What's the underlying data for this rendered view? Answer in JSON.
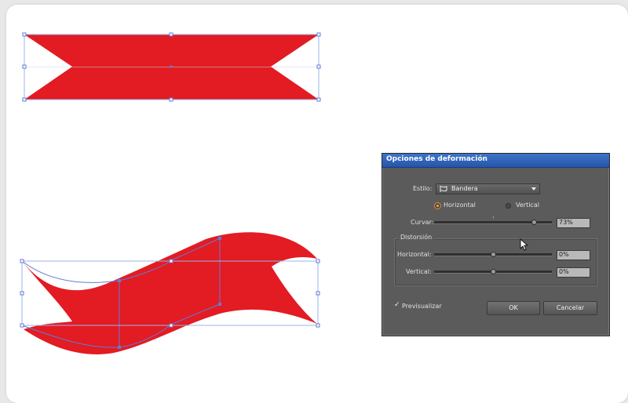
{
  "dialog": {
    "title": "Opciones de deformación",
    "style_label": "Estilo:",
    "style_value": "Bandera",
    "orientation": {
      "horizontal_label": "Horizontal",
      "vertical_label": "Vertical",
      "selected": "Horizontal"
    },
    "bend": {
      "label": "Curvar:",
      "value": "73%"
    },
    "distortion": {
      "group_label": "Distorsión",
      "horizontal": {
        "label": "Horizontal:",
        "value": "0%"
      },
      "vertical": {
        "label": "Vertical:",
        "value": "0%"
      }
    },
    "preview": {
      "label": "Previsualizar",
      "checked": true,
      "check_glyph": "✓"
    },
    "ok_label": "OK",
    "cancel_label": "Cancelar"
  },
  "colors": {
    "banner_red": "#e31b23",
    "selection_blue": "#5f7cd6",
    "dialog_bg": "#5b5b5b",
    "title_blue": "#2f62b8",
    "radio_orange": "#e88a2e"
  },
  "icons": {
    "style_icon": "flag-style-icon",
    "dropdown": "chevron-down-icon",
    "cursor": "mouse-pointer-icon"
  }
}
